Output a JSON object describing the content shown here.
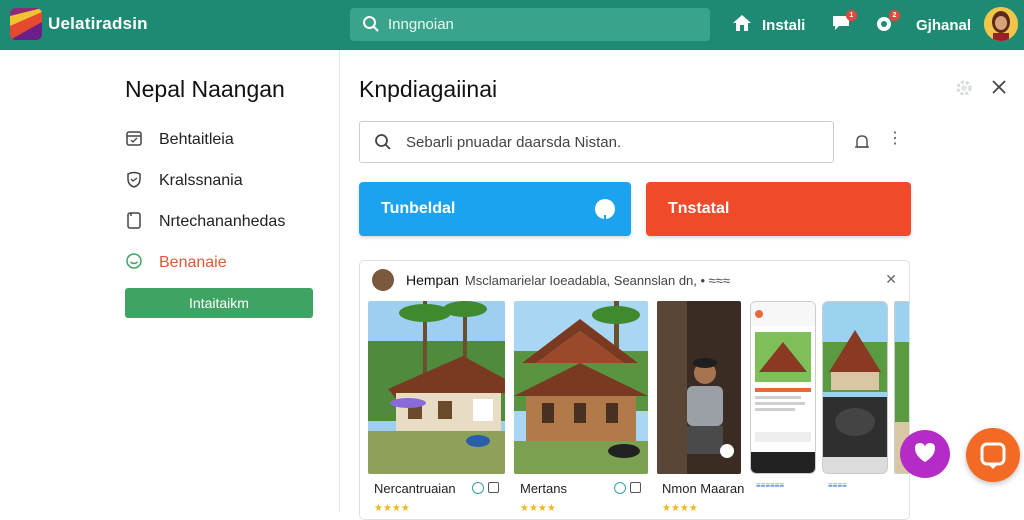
{
  "topbar": {
    "app_title": "Uelatiradsin",
    "search_placeholder": "Inngnoian",
    "install_label": "Instali",
    "notif_count_1": "1",
    "notif_count_2": "2",
    "user_label": "Gjhanal"
  },
  "sidebar": {
    "title": "Nepal Naangan",
    "items": [
      {
        "label": "Behtaitleia",
        "icon": "calendar-icon"
      },
      {
        "label": "Kralssnania",
        "icon": "shield-icon"
      },
      {
        "label": "Nrtechananhedas",
        "icon": "document-icon"
      },
      {
        "label": "Benanaie",
        "icon": "smile-icon"
      }
    ],
    "button_label": "Intaitaikm"
  },
  "main": {
    "title": "Knpdiagaiinai",
    "search_text": "Sebarli pnuadar daarsda Nistan."
  },
  "buttons": {
    "primary_label": "Tunbeldal",
    "secondary_label": "Tnstatal"
  },
  "card": {
    "name": "Hempan",
    "subtitle": "Msclamarielar Ioeadabla, Seannslan dn, • ≈≈≈",
    "items": [
      {
        "label": "Nercantruaian",
        "rating": "★★★★"
      },
      {
        "label": "Mertans",
        "rating": "★★★★"
      },
      {
        "label": "Nmon Maaran",
        "rating": "★★★★"
      }
    ]
  },
  "colors": {
    "topbar": "#1f8a74",
    "accent_green": "#3fa463",
    "primary_blue": "#1ca3f0",
    "danger_red": "#f04a2a",
    "active_orange": "#d95a36"
  }
}
